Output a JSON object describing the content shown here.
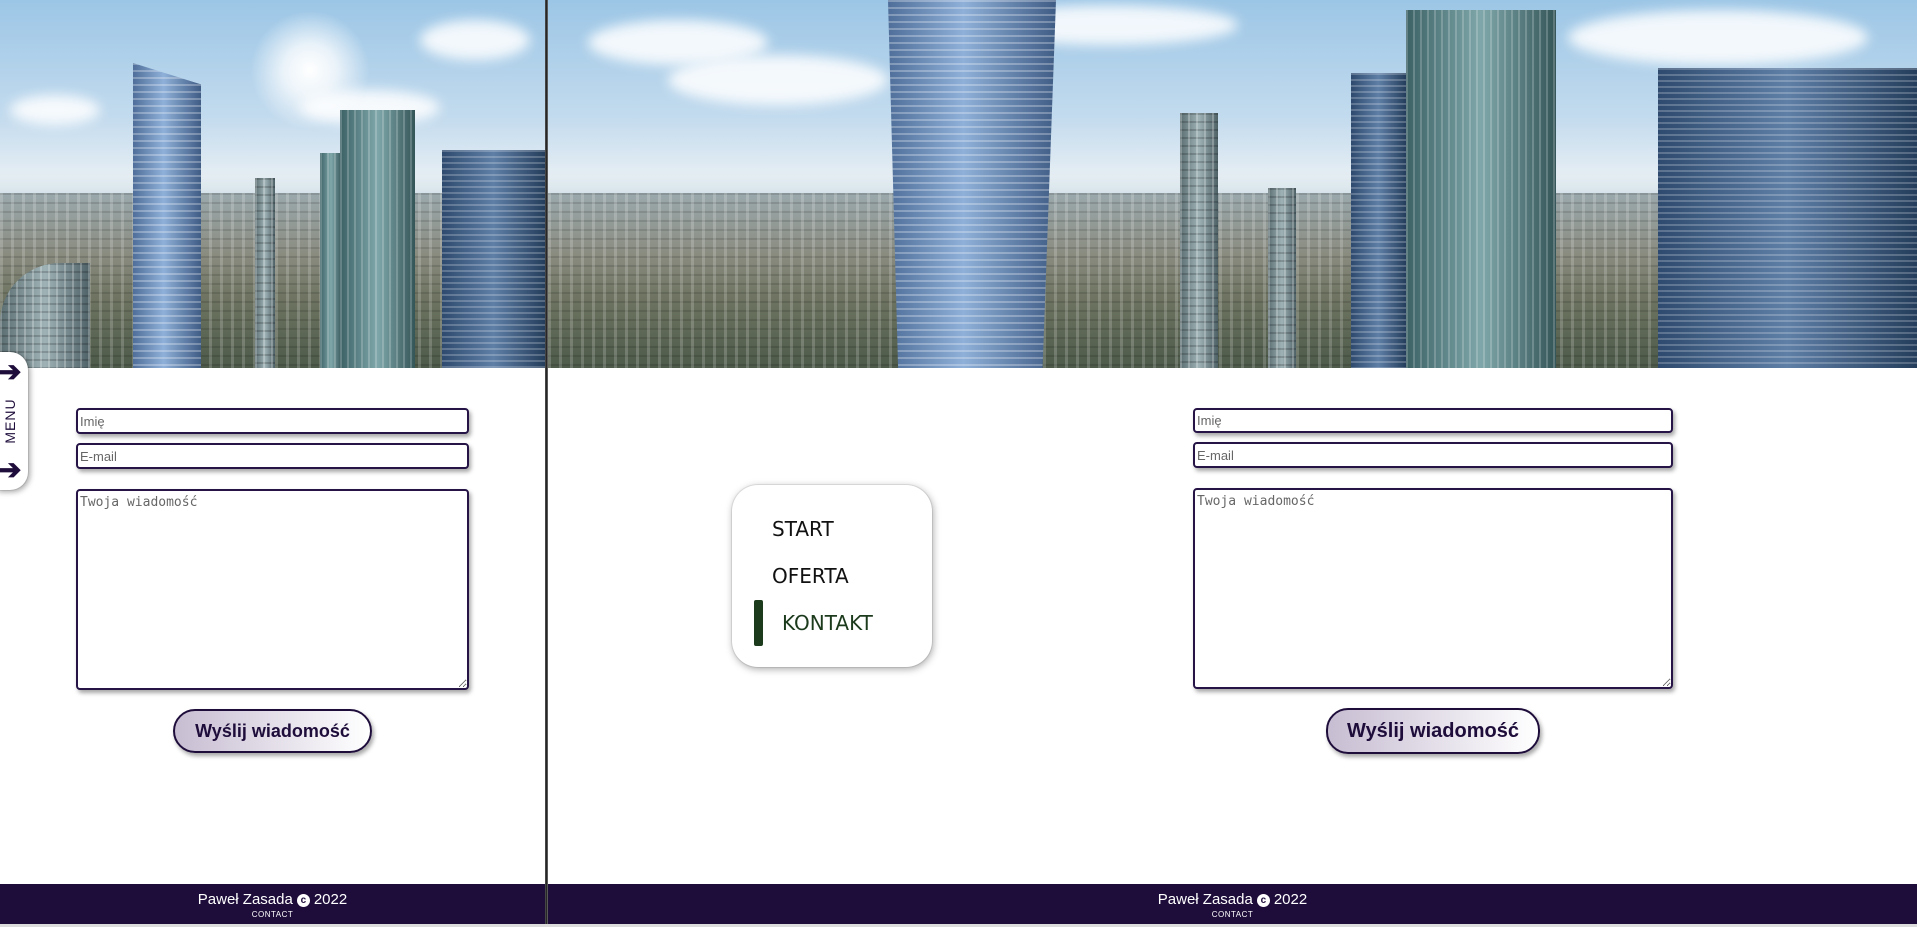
{
  "left_panel": {
    "menu_tab": {
      "label": "MENU",
      "arrow_icon": "arrow-right-icon"
    },
    "form": {
      "name_placeholder": "Imię",
      "email_placeholder": "E-mail",
      "message_placeholder": "Twoja wiadomość",
      "submit_label": "Wyślij wiadomość"
    },
    "footer": {
      "author": "Paweł Zasada",
      "copyright_symbol": "c",
      "year": "2022",
      "link": "CONTACT"
    }
  },
  "right_panel": {
    "nav": {
      "items": [
        {
          "label": "START",
          "active": false
        },
        {
          "label": "OFERTA",
          "active": false
        },
        {
          "label": "KONTAKT",
          "active": true
        }
      ],
      "active_color": "#1c3a1c"
    },
    "form": {
      "name_placeholder": "Imię",
      "email_placeholder": "E-mail",
      "message_placeholder": "Twoja wiadomość",
      "submit_label": "Wyślij wiadomość"
    },
    "footer": {
      "author": "Paweł Zasada",
      "copyright_symbol": "c",
      "year": "2022",
      "link": "CONTACT"
    }
  },
  "colors": {
    "brand_dark": "#1e0d3b",
    "field_border": "#261447",
    "button_gradient_start": "#c7bdd2"
  }
}
